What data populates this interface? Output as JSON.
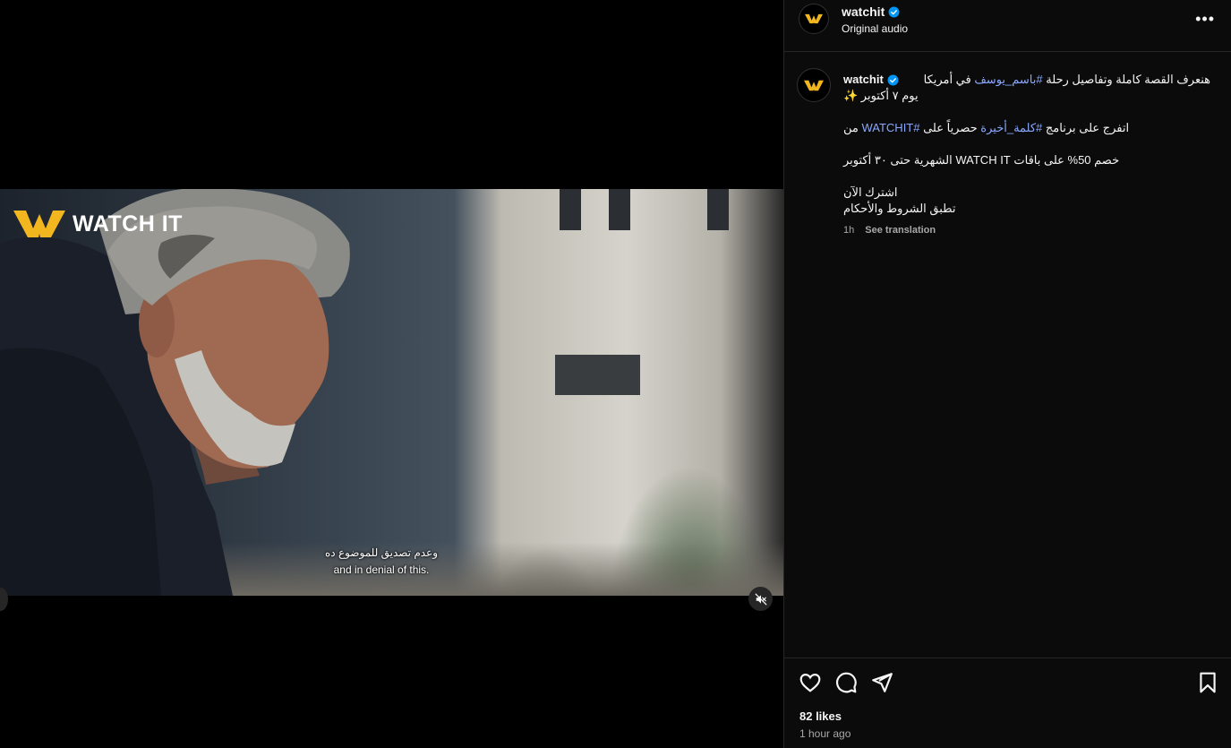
{
  "post": {
    "username": "watchit",
    "audio": "Original audio",
    "more_icon": "more-horizontal-icon"
  },
  "video": {
    "watermark": "WATCH IT",
    "subtitle_ar": "وعدم تصديق للموضوع ده",
    "subtitle_en": "and in denial of this.",
    "muted": true
  },
  "caption": {
    "username": "watchit",
    "line1_a": "هنعرف القصة كاملة وتفاصيل رحلة ",
    "line1_tag": "#باسم_يوسف",
    "line1_b": " في أمريكا",
    "line2": "يوم ٧ أكتوبر ✨",
    "line3_a": "اتفرج على برنامج ",
    "line3_tag1": "#كلمة_أخيرة",
    "line3_b": " حصرياً على ",
    "line3_tag2": "#WATCHIT",
    "line3_c": " من",
    "line4": "خصم 50% على باقات WATCH IT الشهرية حتى ٣٠ أكتوبر",
    "line5": "اشترك الآن",
    "line6": "تطبق الشروط والأحكام",
    "time": "1h",
    "translate": "See translation"
  },
  "actions": {
    "likes": "82 likes",
    "posted": "1 hour ago"
  },
  "colors": {
    "accent_link": "#8aa8ff",
    "verified": "#0095f6",
    "brand_yellow": "#f2b71f"
  }
}
